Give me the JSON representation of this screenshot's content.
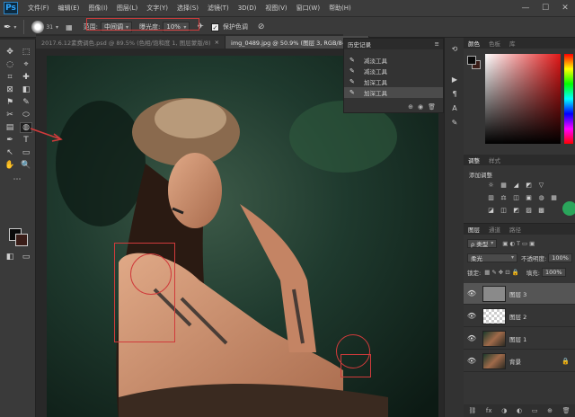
{
  "menu": {
    "logo": "Ps",
    "items": [
      "文件(F)",
      "编辑(E)",
      "图像(I)",
      "图层(L)",
      "文字(Y)",
      "选择(S)",
      "滤镜(T)",
      "3D(D)",
      "视图(V)",
      "窗口(W)",
      "帮助(H)"
    ]
  },
  "window_controls": [
    "—",
    "☐",
    "✕"
  ],
  "options": {
    "brush_size": "31",
    "range_label": "范围:",
    "range_value": "中间调",
    "exposure_label": "曝光度:",
    "exposure_value": "10%",
    "protect_label": "保护色调",
    "protect_checked": "✓"
  },
  "tabs": [
    {
      "label": "2017.6.12素费调色.psd @ 89.5% (色相/饱和度 1, 图层蒙版/8)",
      "close": "×"
    },
    {
      "label": "img_0489.jpg @ 50.9% (图层 3, RGB/8#) *",
      "close": "×"
    }
  ],
  "toolbar": {
    "tools": [
      "✥",
      "⬚",
      "◌",
      "⌖",
      "⌗",
      "✚",
      "⊠",
      "◧",
      "⚑",
      "✎",
      "✂",
      "⬭",
      "▤",
      "◍",
      "●",
      "✒",
      "T",
      "↖",
      "▭",
      "✋",
      "🔍",
      "⋯"
    ],
    "fg_color": "#0a0a0a",
    "bg_color": "#3a1d18"
  },
  "history": {
    "title": "历史记录",
    "menu": "≡",
    "items": [
      "减淡工具",
      "减淡工具",
      "加深工具",
      "加深工具"
    ],
    "footer_icons": [
      "⊕",
      "◉",
      "🗑"
    ]
  },
  "color_panel": {
    "tabs": [
      "颜色",
      "色板",
      "库"
    ],
    "fg": "#0a0a0a",
    "bg": "#3a1d18"
  },
  "adjust_panel": {
    "tabs": [
      "调整",
      "样式"
    ],
    "title": "添加调整",
    "icons_row1": [
      "☼",
      "▦",
      "◢",
      "◩",
      "▽"
    ],
    "icons_row2": [
      "▥",
      "⚖",
      "◫",
      "▣",
      "◍",
      "▦"
    ],
    "icons_row3": [
      "◪",
      "◫",
      "◩",
      "▨",
      "▩"
    ]
  },
  "layers_panel": {
    "tabs": [
      "图层",
      "通道",
      "路径"
    ],
    "kind_label": "ρ 类型",
    "blend_mode": "柔光",
    "opacity_label": "不透明度:",
    "opacity_value": "100%",
    "lock_label": "锁定:",
    "fill_label": "填充:",
    "fill_value": "100%",
    "layers": [
      {
        "name": "图层 3",
        "eye": "👁"
      },
      {
        "name": "图层 2",
        "eye": "👁"
      },
      {
        "name": "图层 1",
        "eye": "👁"
      },
      {
        "name": "背景",
        "eye": "👁"
      }
    ],
    "footer_icons": [
      "⛓",
      "fx",
      "◑",
      "◐",
      "▭",
      "⊕",
      "🗑"
    ]
  }
}
